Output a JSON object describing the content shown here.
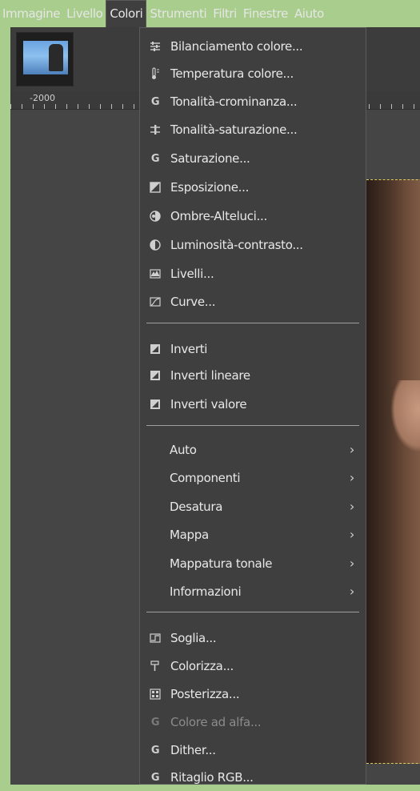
{
  "menubar": {
    "items": [
      "Immagine",
      "Livello",
      "Colori",
      "Strumenti",
      "Filtri",
      "Finestre",
      "Aiuto"
    ],
    "active": "Colori"
  },
  "ruler": {
    "label": "-2000"
  },
  "menu": {
    "group1": [
      {
        "label": "Bilanciamento colore...",
        "icon": "color-balance-icon"
      },
      {
        "label": "Temperatura colore...",
        "icon": "thermometer-icon"
      },
      {
        "label": "Tonalità-crominanza...",
        "icon": "g-icon"
      },
      {
        "label": "Tonalità-saturazione...",
        "icon": "hue-saturation-icon"
      },
      {
        "label": "Saturazione...",
        "icon": "g-icon"
      },
      {
        "label": "Esposizione...",
        "icon": "exposure-icon"
      },
      {
        "label": "Ombre-Alteluci...",
        "icon": "shadows-highlights-icon"
      },
      {
        "label": "Luminosità-contrasto...",
        "icon": "brightness-contrast-icon"
      },
      {
        "label": "Livelli...",
        "icon": "levels-icon"
      },
      {
        "label": "Curve...",
        "icon": "curves-icon"
      }
    ],
    "group2": [
      {
        "label": "Inverti",
        "icon": "invert-icon"
      },
      {
        "label": "Inverti lineare",
        "icon": "invert-icon"
      },
      {
        "label": "Inverti valore",
        "icon": "invert-icon"
      }
    ],
    "group3": [
      {
        "label": "Auto",
        "arrow": "›"
      },
      {
        "label": "Componenti",
        "arrow": "›"
      },
      {
        "label": "Desatura",
        "arrow": "›"
      },
      {
        "label": "Mappa",
        "arrow": "›"
      },
      {
        "label": "Mappatura tonale",
        "arrow": "›"
      },
      {
        "label": "Informazioni",
        "arrow": "›"
      }
    ],
    "group4": [
      {
        "label": "Soglia...",
        "icon": "threshold-icon"
      },
      {
        "label": "Colorizza...",
        "icon": "colorize-icon"
      },
      {
        "label": "Posterizza...",
        "icon": "posterize-icon"
      },
      {
        "label": "Colore ad alfa...",
        "icon": "g-icon",
        "disabled": true
      },
      {
        "label": "Dither...",
        "icon": "g-icon"
      },
      {
        "label": "Ritaglio RGB...",
        "icon": "g-icon"
      }
    ]
  }
}
